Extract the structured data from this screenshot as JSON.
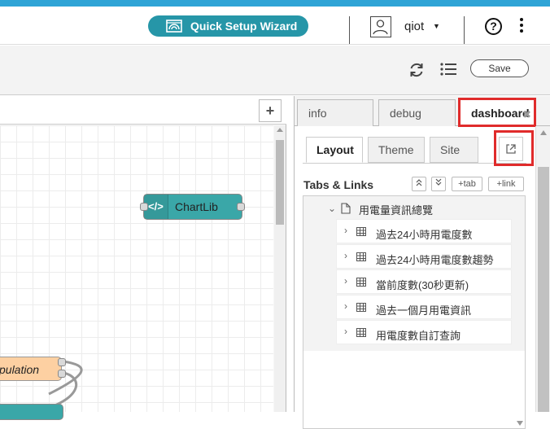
{
  "header": {
    "wizard_label": "Quick Setup Wizard",
    "user_name": "qiot",
    "help_label": "?"
  },
  "toolbar": {
    "save_label": "Save"
  },
  "canvas": {
    "add_flow_label": "+",
    "nodes": {
      "chartlib_label": "ChartLib",
      "chartlib_icon": "</>",
      "manipulation_label": "pulation"
    }
  },
  "sidebar": {
    "tabs": [
      {
        "label": "info"
      },
      {
        "label": "debug"
      },
      {
        "label": "dashboard",
        "active": true
      }
    ],
    "dashboard": {
      "subtabs": [
        {
          "label": "Layout",
          "active": true
        },
        {
          "label": "Theme"
        },
        {
          "label": "Site"
        }
      ],
      "section_title": "Tabs & Links",
      "buttons": {
        "add_tab": "+tab",
        "add_link": "+link"
      },
      "tree": {
        "tab_name": "用電量資訊總覽",
        "groups": [
          "過去24小時用電度數",
          "過去24小時用電度數趨勢",
          "當前度數(30秒更新)",
          "過去一個月用電資訊",
          "用電度數自訂查詢"
        ]
      }
    }
  },
  "colors": {
    "accent_blue": "#2fa4d6",
    "wizard_teal": "#2696a8",
    "highlight_red": "#e02b2b",
    "node_teal": "#3aa7a8",
    "node_orange": "#fdd0a2"
  }
}
